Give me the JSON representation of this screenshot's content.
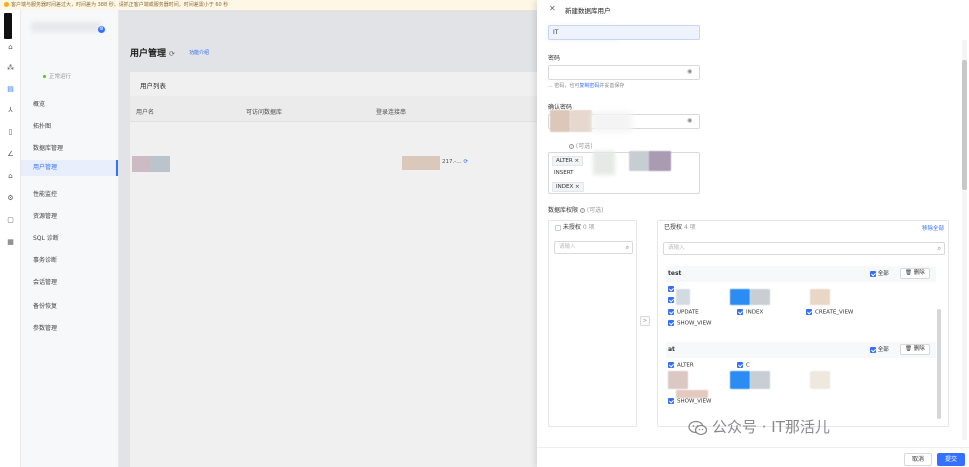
{
  "banner": {
    "text": "客户端与服务器时间差过大，时间差为 388 秒。请抓正客户端或服务器时间，时间差需小于 60 秒"
  },
  "menu": {
    "status": "正常运行",
    "items": [
      "概览",
      "拓扑图",
      "数据库管理",
      "用户管理",
      "性能监控",
      "资源管理",
      "SQL 诊断",
      "事务诊断",
      "会话管理",
      "备份恢复",
      "参数管理"
    ],
    "active_index": 3
  },
  "main": {
    "title": "用户管理",
    "link": "功能介绍",
    "card_title": "用户列表",
    "columns": [
      "用户名",
      "可访问数据库",
      "登录连接串"
    ],
    "row_endpoint": "217.-..."
  },
  "drawer": {
    "title": "新建数据库用户",
    "username_value": "IT",
    "password_label": "密码",
    "password_hint_prefix": "... 密码，也可",
    "password_hint_link": "复制密码",
    "password_hint_suffix": "并妥善保存",
    "confirm_label": "确认密码",
    "priv_label_tail": "(可选)",
    "priv_tags": [
      "ALTER",
      "INSERT",
      "INDEX"
    ],
    "db_priv_label": "数据库权限",
    "db_priv_optional": "(可选)",
    "unauth": {
      "title": "未授权",
      "count": "0 项",
      "search_placeholder": "请输入"
    },
    "auth": {
      "title": "已授权",
      "count": "4 项",
      "remove_all": "移除全部",
      "search_placeholder": "请输入",
      "sections": [
        {
          "name": "test",
          "all": "全部",
          "delete": "删除",
          "privs": [
            "UPDATE",
            "INDEX",
            "CREATE_VIEW",
            "SHOW_VIEW"
          ]
        },
        {
          "name": "at",
          "all": "全部",
          "delete": "删除",
          "privs": [
            "ALTER",
            "C",
            "SHOW_VIEW"
          ]
        }
      ]
    },
    "cancel": "取消",
    "submit": "提交"
  },
  "watermark": "公众号 · IT那活儿",
  "colors": {
    "accent": "#3370ff",
    "warning": "#faad14",
    "success": "#52c41a"
  }
}
